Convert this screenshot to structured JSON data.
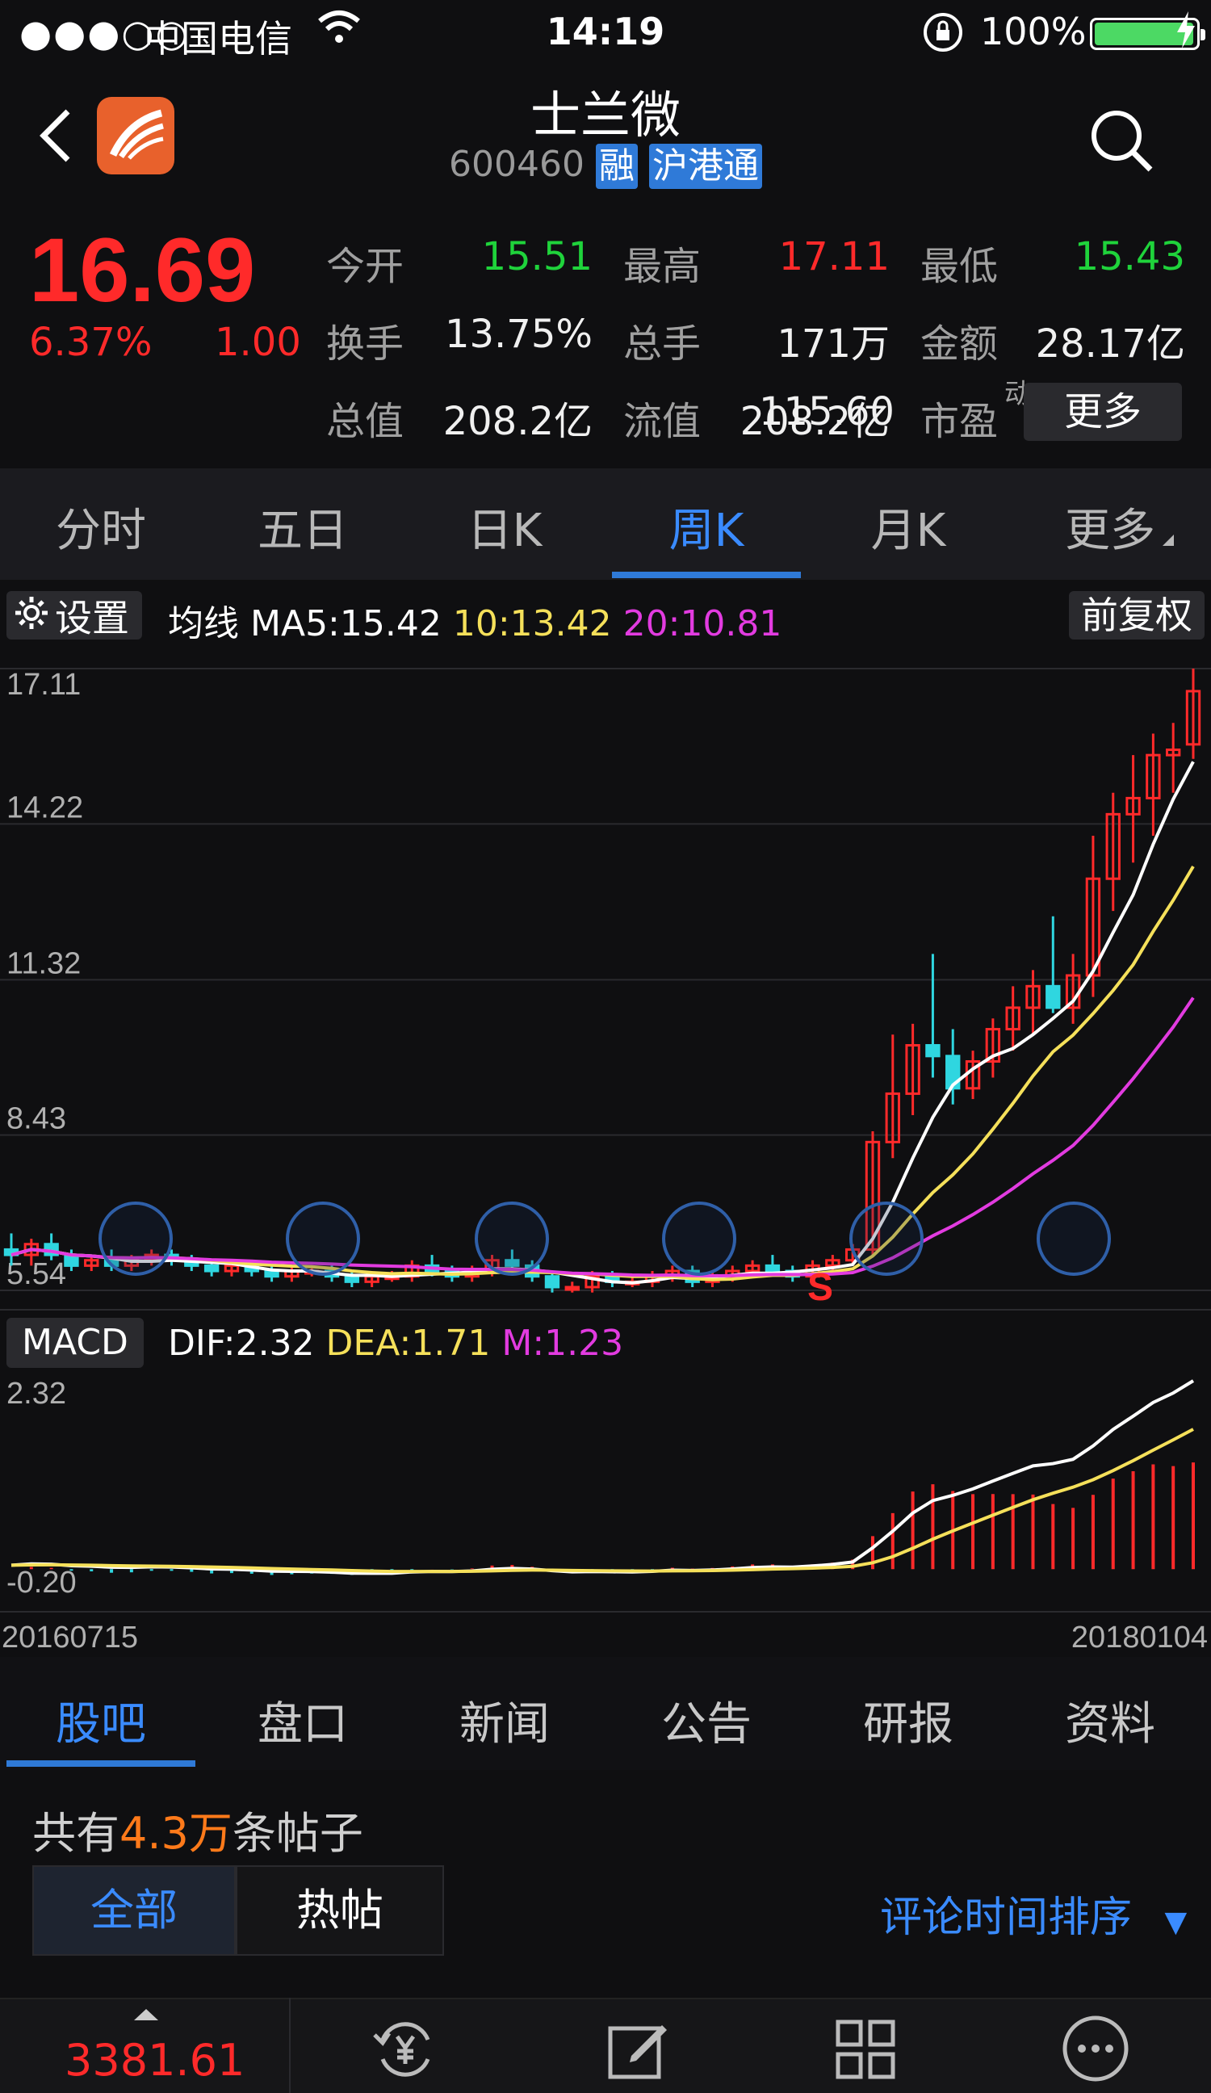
{
  "status_bar": {
    "signal": "●●●○○",
    "carrier": "中国电信",
    "time": "14:19",
    "battery": "100%"
  },
  "stock": {
    "name": "士兰微",
    "code": "600460",
    "tags": [
      "融",
      "沪港通"
    ],
    "price": "16.69",
    "change_pct": "6.37%",
    "change_amt": "1.00"
  },
  "quote": [
    {
      "label": "今开",
      "value": "15.51",
      "color": "#1fd33b"
    },
    {
      "label": "最高",
      "value": "17.11",
      "color": "#ff2a2a"
    },
    {
      "label": "最低",
      "value": "15.43",
      "color": "#1fd33b"
    },
    {
      "label": "换手",
      "value": "13.75%",
      "color": "#f0f0f0"
    },
    {
      "label": "总手",
      "value": "171万",
      "color": "#f0f0f0"
    },
    {
      "label": "金额",
      "value": "28.17亿",
      "color": "#f0f0f0"
    },
    {
      "label": "总值",
      "value": "208.2亿",
      "color": "#f0f0f0"
    },
    {
      "label": "流值",
      "value": "208.2亿",
      "color": "#f0f0f0"
    },
    {
      "label": "市盈",
      "sup": "动",
      "value": "115.60",
      "color": "#f0f0f0"
    }
  ],
  "more_label": "更多",
  "period_tabs": [
    "分时",
    "五日",
    "日K",
    "周K",
    "月K",
    "更多"
  ],
  "active_period": "周K",
  "chart_header": {
    "settings": "设置",
    "ma_title": "均线",
    "ma5": "MA5:15.42",
    "ma10": "10:13.42",
    "ma20": "20:10.81",
    "adjust": "前复权"
  },
  "macd_header": {
    "label": "MACD",
    "dif": "DIF:2.32",
    "dea": "DEA:1.71",
    "m": "M:1.23"
  },
  "chart_data": [
    {
      "type": "candlestick",
      "title": "周K",
      "y_ticks": [
        "17.11",
        "14.22",
        "11.32",
        "8.43",
        "5.54"
      ],
      "ylim": [
        5.54,
        17.11
      ],
      "x_start": "20160715",
      "x_end": "20180104",
      "ma_colors": {
        "ma5": "#ffffff",
        "ma10": "#f5e05a",
        "ma20": "#e23be0"
      },
      "candles_ohlc": [
        [
          6.3,
          6.6,
          6.0,
          6.2
        ],
        [
          6.2,
          6.5,
          6.0,
          6.4
        ],
        [
          6.4,
          6.6,
          6.1,
          6.2
        ],
        [
          6.2,
          6.3,
          5.9,
          6.0
        ],
        [
          6.0,
          6.2,
          5.9,
          6.1
        ],
        [
          6.1,
          6.3,
          5.9,
          6.0
        ],
        [
          6.0,
          6.2,
          5.9,
          6.1
        ],
        [
          6.1,
          6.3,
          6.0,
          6.2
        ],
        [
          6.2,
          6.3,
          6.0,
          6.1
        ],
        [
          6.1,
          6.2,
          5.9,
          6.0
        ],
        [
          6.0,
          6.1,
          5.8,
          5.9
        ],
        [
          5.9,
          6.1,
          5.8,
          6.0
        ],
        [
          6.0,
          6.1,
          5.8,
          5.9
        ],
        [
          5.9,
          6.0,
          5.7,
          5.8
        ],
        [
          5.8,
          6.0,
          5.7,
          5.9
        ],
        [
          5.9,
          6.0,
          5.8,
          5.9
        ],
        [
          5.9,
          6.0,
          5.7,
          5.8
        ],
        [
          5.8,
          5.9,
          5.6,
          5.7
        ],
        [
          5.7,
          5.9,
          5.6,
          5.8
        ],
        [
          5.8,
          5.9,
          5.7,
          5.8
        ],
        [
          5.8,
          6.1,
          5.7,
          6.0
        ],
        [
          6.0,
          6.2,
          5.8,
          5.9
        ],
        [
          5.9,
          6.0,
          5.7,
          5.8
        ],
        [
          5.8,
          6.0,
          5.7,
          5.9
        ],
        [
          5.9,
          6.2,
          5.8,
          6.1
        ],
        [
          6.1,
          6.3,
          5.9,
          6.0
        ],
        [
          6.0,
          6.1,
          5.7,
          5.8
        ],
        [
          5.8,
          5.9,
          5.5,
          5.6
        ],
        [
          5.6,
          5.7,
          5.5,
          5.6
        ],
        [
          5.6,
          5.9,
          5.5,
          5.8
        ],
        [
          5.8,
          5.9,
          5.6,
          5.7
        ],
        [
          5.7,
          5.8,
          5.6,
          5.7
        ],
        [
          5.7,
          5.9,
          5.6,
          5.8
        ],
        [
          5.8,
          6.0,
          5.7,
          5.9
        ],
        [
          5.9,
          6.0,
          5.6,
          5.7
        ],
        [
          5.7,
          5.9,
          5.6,
          5.8
        ],
        [
          5.8,
          6.0,
          5.7,
          5.9
        ],
        [
          5.9,
          6.1,
          5.8,
          6.0
        ],
        [
          6.0,
          6.2,
          5.8,
          5.9
        ],
        [
          5.9,
          6.0,
          5.7,
          5.8
        ],
        [
          5.8,
          6.1,
          5.7,
          6.0
        ],
        [
          6.0,
          6.2,
          5.9,
          6.1
        ],
        [
          6.1,
          6.4,
          6.0,
          6.3
        ],
        [
          6.3,
          8.5,
          6.2,
          8.3
        ],
        [
          8.3,
          10.3,
          8.0,
          9.2
        ],
        [
          9.2,
          10.5,
          8.8,
          10.1
        ],
        [
          10.1,
          11.8,
          9.5,
          9.9
        ],
        [
          9.9,
          10.4,
          9.0,
          9.3
        ],
        [
          9.3,
          10.0,
          9.1,
          9.8
        ],
        [
          9.8,
          10.6,
          9.5,
          10.4
        ],
        [
          10.4,
          11.2,
          10.0,
          10.8
        ],
        [
          10.8,
          11.5,
          10.3,
          11.2
        ],
        [
          11.2,
          12.5,
          10.7,
          10.8
        ],
        [
          10.8,
          11.8,
          10.5,
          11.4
        ],
        [
          11.4,
          14.0,
          11.0,
          13.2
        ],
        [
          13.2,
          14.8,
          12.6,
          14.4
        ],
        [
          14.4,
          15.5,
          13.5,
          14.7
        ],
        [
          14.7,
          15.9,
          14.0,
          15.5
        ],
        [
          15.5,
          16.1,
          14.8,
          15.6
        ],
        [
          15.7,
          17.11,
          15.43,
          16.69
        ]
      ]
    },
    {
      "type": "bar",
      "title": "MACD",
      "y_ticks": [
        "2.32",
        "-0.20"
      ],
      "ylim": [
        -0.2,
        2.32
      ],
      "dif_last": 2.32,
      "dea_last": 1.71,
      "m_last": 1.23
    }
  ],
  "bottom_tabs": [
    "股吧",
    "盘口",
    "新闻",
    "公告",
    "研报",
    "资料"
  ],
  "active_bottom_tab": "股吧",
  "posts": {
    "prefix": "共有",
    "count": "4.3万",
    "suffix": "条帖子"
  },
  "filters": {
    "all": "全部",
    "hot": "热帖",
    "sort": "评论时间排序"
  },
  "index_value": "3381.61"
}
